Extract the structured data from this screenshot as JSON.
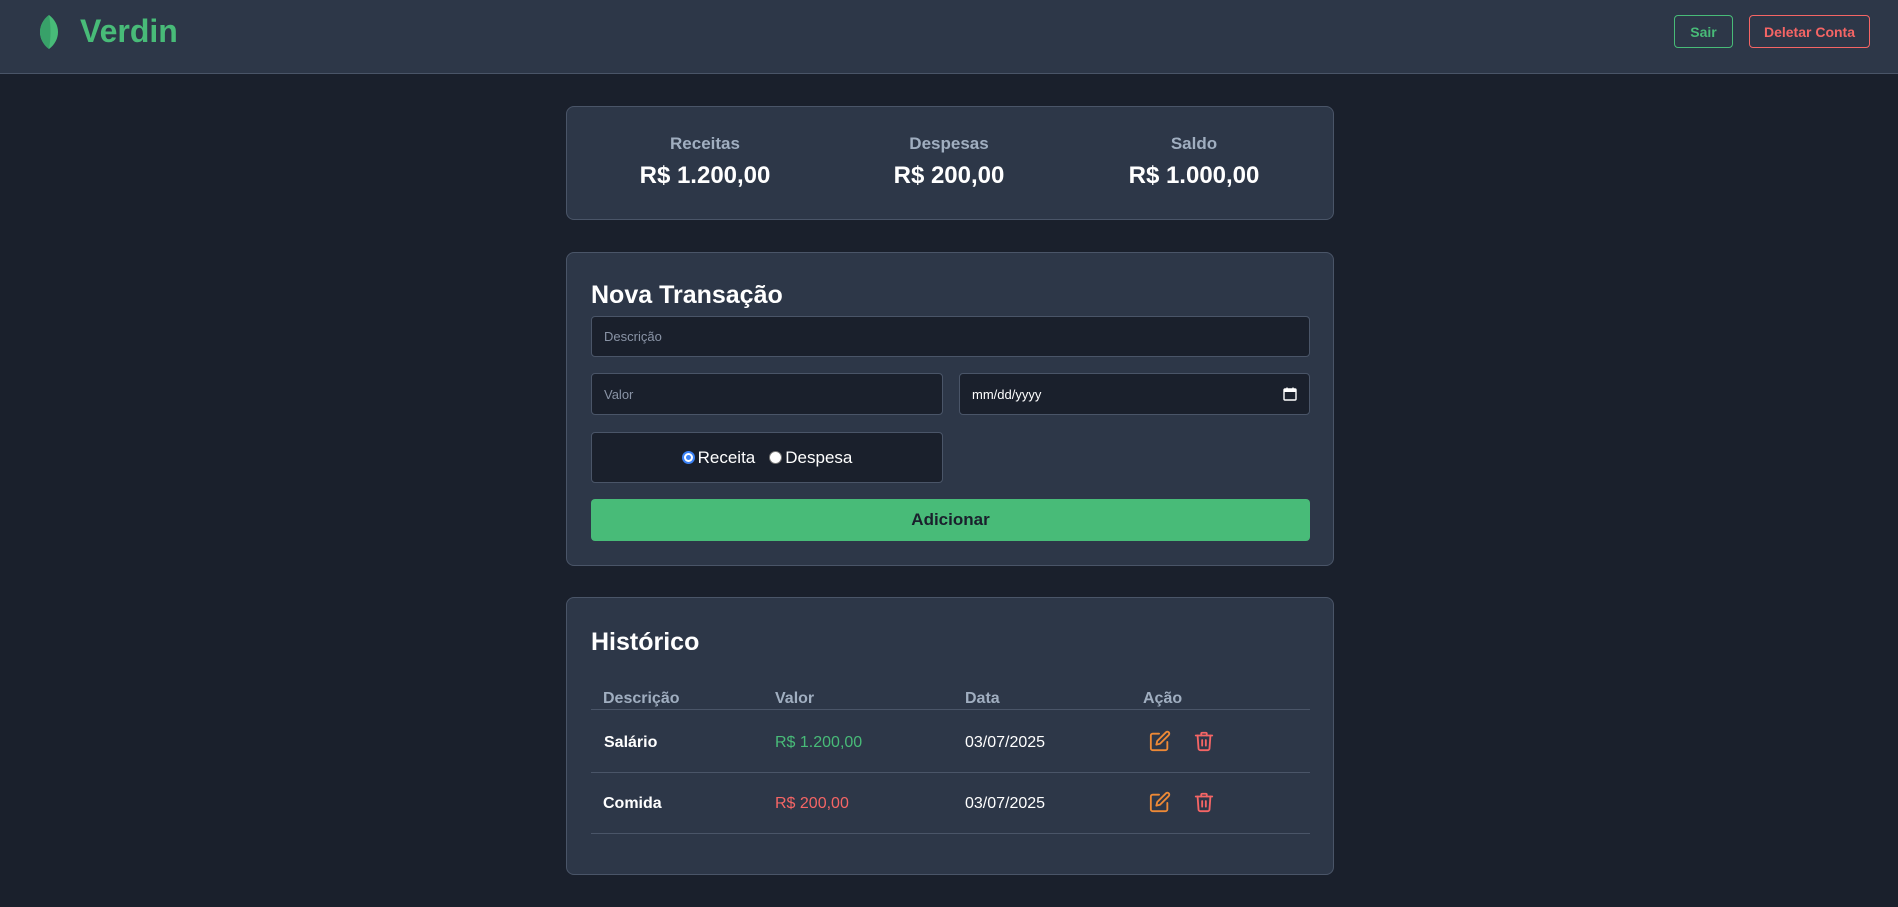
{
  "header": {
    "brand": "Verdin",
    "logout_label": "Sair",
    "delete_account_label": "Deletar Conta"
  },
  "summary": {
    "income_label": "Receitas",
    "income_value": "R$ 1.200,00",
    "expense_label": "Despesas",
    "expense_value": "R$ 200,00",
    "balance_label": "Saldo",
    "balance_value": "R$ 1.000,00"
  },
  "form": {
    "title": "Nova Transação",
    "description_placeholder": "Descrição",
    "description_value": "",
    "amount_placeholder": "Valor",
    "amount_value": "",
    "date_placeholder": "mm/dd/yyyy",
    "type_options": [
      "Receita",
      "Despesa"
    ],
    "type_selected": "Receita",
    "submit_label": "Adicionar"
  },
  "history": {
    "title": "Histórico",
    "columns": [
      "Descrição",
      "Valor",
      "Data",
      "Ação"
    ],
    "rows": [
      {
        "description": "Salário",
        "amount": "R$ 1.200,00",
        "date": "03/07/2025",
        "type": "income"
      },
      {
        "description": "Comida",
        "amount": "R$ 200,00",
        "date": "03/07/2025",
        "type": "expense"
      }
    ]
  },
  "icons": {
    "logo": "leaf-icon",
    "date": "calendar-icon",
    "edit": "edit-icon",
    "delete": "trash-icon"
  },
  "colors": {
    "background": "#1a202c",
    "card": "#2d3748",
    "accent_green": "#48bb78",
    "accent_red": "#f56565",
    "edit_orange": "#ed8936",
    "muted_text": "#a0aec0"
  }
}
